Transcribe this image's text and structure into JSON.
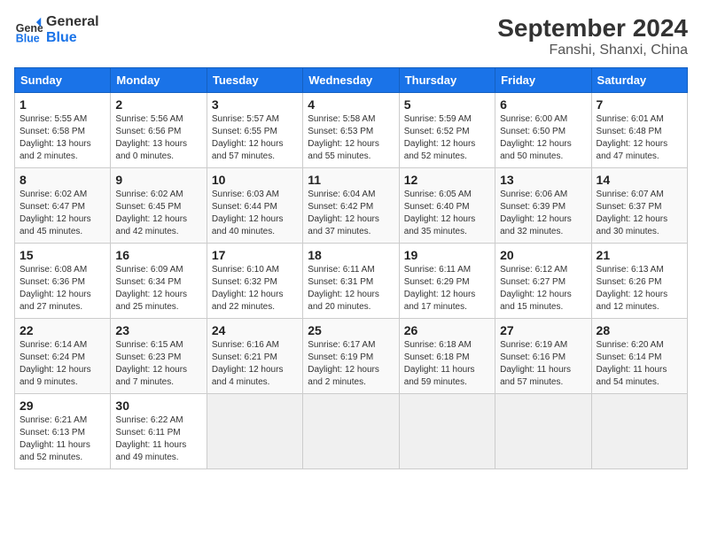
{
  "header": {
    "logo_line1": "General",
    "logo_line2": "Blue",
    "title": "September 2024",
    "subtitle": "Fanshi, Shanxi, China"
  },
  "days_of_week": [
    "Sunday",
    "Monday",
    "Tuesday",
    "Wednesday",
    "Thursday",
    "Friday",
    "Saturday"
  ],
  "weeks": [
    [
      {
        "day": 1,
        "sunrise": "5:55 AM",
        "sunset": "6:58 PM",
        "daylight": "13 hours and 2 minutes."
      },
      {
        "day": 2,
        "sunrise": "5:56 AM",
        "sunset": "6:56 PM",
        "daylight": "13 hours and 0 minutes."
      },
      {
        "day": 3,
        "sunrise": "5:57 AM",
        "sunset": "6:55 PM",
        "daylight": "12 hours and 57 minutes."
      },
      {
        "day": 4,
        "sunrise": "5:58 AM",
        "sunset": "6:53 PM",
        "daylight": "12 hours and 55 minutes."
      },
      {
        "day": 5,
        "sunrise": "5:59 AM",
        "sunset": "6:52 PM",
        "daylight": "12 hours and 52 minutes."
      },
      {
        "day": 6,
        "sunrise": "6:00 AM",
        "sunset": "6:50 PM",
        "daylight": "12 hours and 50 minutes."
      },
      {
        "day": 7,
        "sunrise": "6:01 AM",
        "sunset": "6:48 PM",
        "daylight": "12 hours and 47 minutes."
      }
    ],
    [
      {
        "day": 8,
        "sunrise": "6:02 AM",
        "sunset": "6:47 PM",
        "daylight": "12 hours and 45 minutes."
      },
      {
        "day": 9,
        "sunrise": "6:02 AM",
        "sunset": "6:45 PM",
        "daylight": "12 hours and 42 minutes."
      },
      {
        "day": 10,
        "sunrise": "6:03 AM",
        "sunset": "6:44 PM",
        "daylight": "12 hours and 40 minutes."
      },
      {
        "day": 11,
        "sunrise": "6:04 AM",
        "sunset": "6:42 PM",
        "daylight": "12 hours and 37 minutes."
      },
      {
        "day": 12,
        "sunrise": "6:05 AM",
        "sunset": "6:40 PM",
        "daylight": "12 hours and 35 minutes."
      },
      {
        "day": 13,
        "sunrise": "6:06 AM",
        "sunset": "6:39 PM",
        "daylight": "12 hours and 32 minutes."
      },
      {
        "day": 14,
        "sunrise": "6:07 AM",
        "sunset": "6:37 PM",
        "daylight": "12 hours and 30 minutes."
      }
    ],
    [
      {
        "day": 15,
        "sunrise": "6:08 AM",
        "sunset": "6:36 PM",
        "daylight": "12 hours and 27 minutes."
      },
      {
        "day": 16,
        "sunrise": "6:09 AM",
        "sunset": "6:34 PM",
        "daylight": "12 hours and 25 minutes."
      },
      {
        "day": 17,
        "sunrise": "6:10 AM",
        "sunset": "6:32 PM",
        "daylight": "12 hours and 22 minutes."
      },
      {
        "day": 18,
        "sunrise": "6:11 AM",
        "sunset": "6:31 PM",
        "daylight": "12 hours and 20 minutes."
      },
      {
        "day": 19,
        "sunrise": "6:11 AM",
        "sunset": "6:29 PM",
        "daylight": "12 hours and 17 minutes."
      },
      {
        "day": 20,
        "sunrise": "6:12 AM",
        "sunset": "6:27 PM",
        "daylight": "12 hours and 15 minutes."
      },
      {
        "day": 21,
        "sunrise": "6:13 AM",
        "sunset": "6:26 PM",
        "daylight": "12 hours and 12 minutes."
      }
    ],
    [
      {
        "day": 22,
        "sunrise": "6:14 AM",
        "sunset": "6:24 PM",
        "daylight": "12 hours and 9 minutes."
      },
      {
        "day": 23,
        "sunrise": "6:15 AM",
        "sunset": "6:23 PM",
        "daylight": "12 hours and 7 minutes."
      },
      {
        "day": 24,
        "sunrise": "6:16 AM",
        "sunset": "6:21 PM",
        "daylight": "12 hours and 4 minutes."
      },
      {
        "day": 25,
        "sunrise": "6:17 AM",
        "sunset": "6:19 PM",
        "daylight": "12 hours and 2 minutes."
      },
      {
        "day": 26,
        "sunrise": "6:18 AM",
        "sunset": "6:18 PM",
        "daylight": "11 hours and 59 minutes."
      },
      {
        "day": 27,
        "sunrise": "6:19 AM",
        "sunset": "6:16 PM",
        "daylight": "11 hours and 57 minutes."
      },
      {
        "day": 28,
        "sunrise": "6:20 AM",
        "sunset": "6:14 PM",
        "daylight": "11 hours and 54 minutes."
      }
    ],
    [
      {
        "day": 29,
        "sunrise": "6:21 AM",
        "sunset": "6:13 PM",
        "daylight": "11 hours and 52 minutes."
      },
      {
        "day": 30,
        "sunrise": "6:22 AM",
        "sunset": "6:11 PM",
        "daylight": "11 hours and 49 minutes."
      },
      null,
      null,
      null,
      null,
      null
    ]
  ]
}
